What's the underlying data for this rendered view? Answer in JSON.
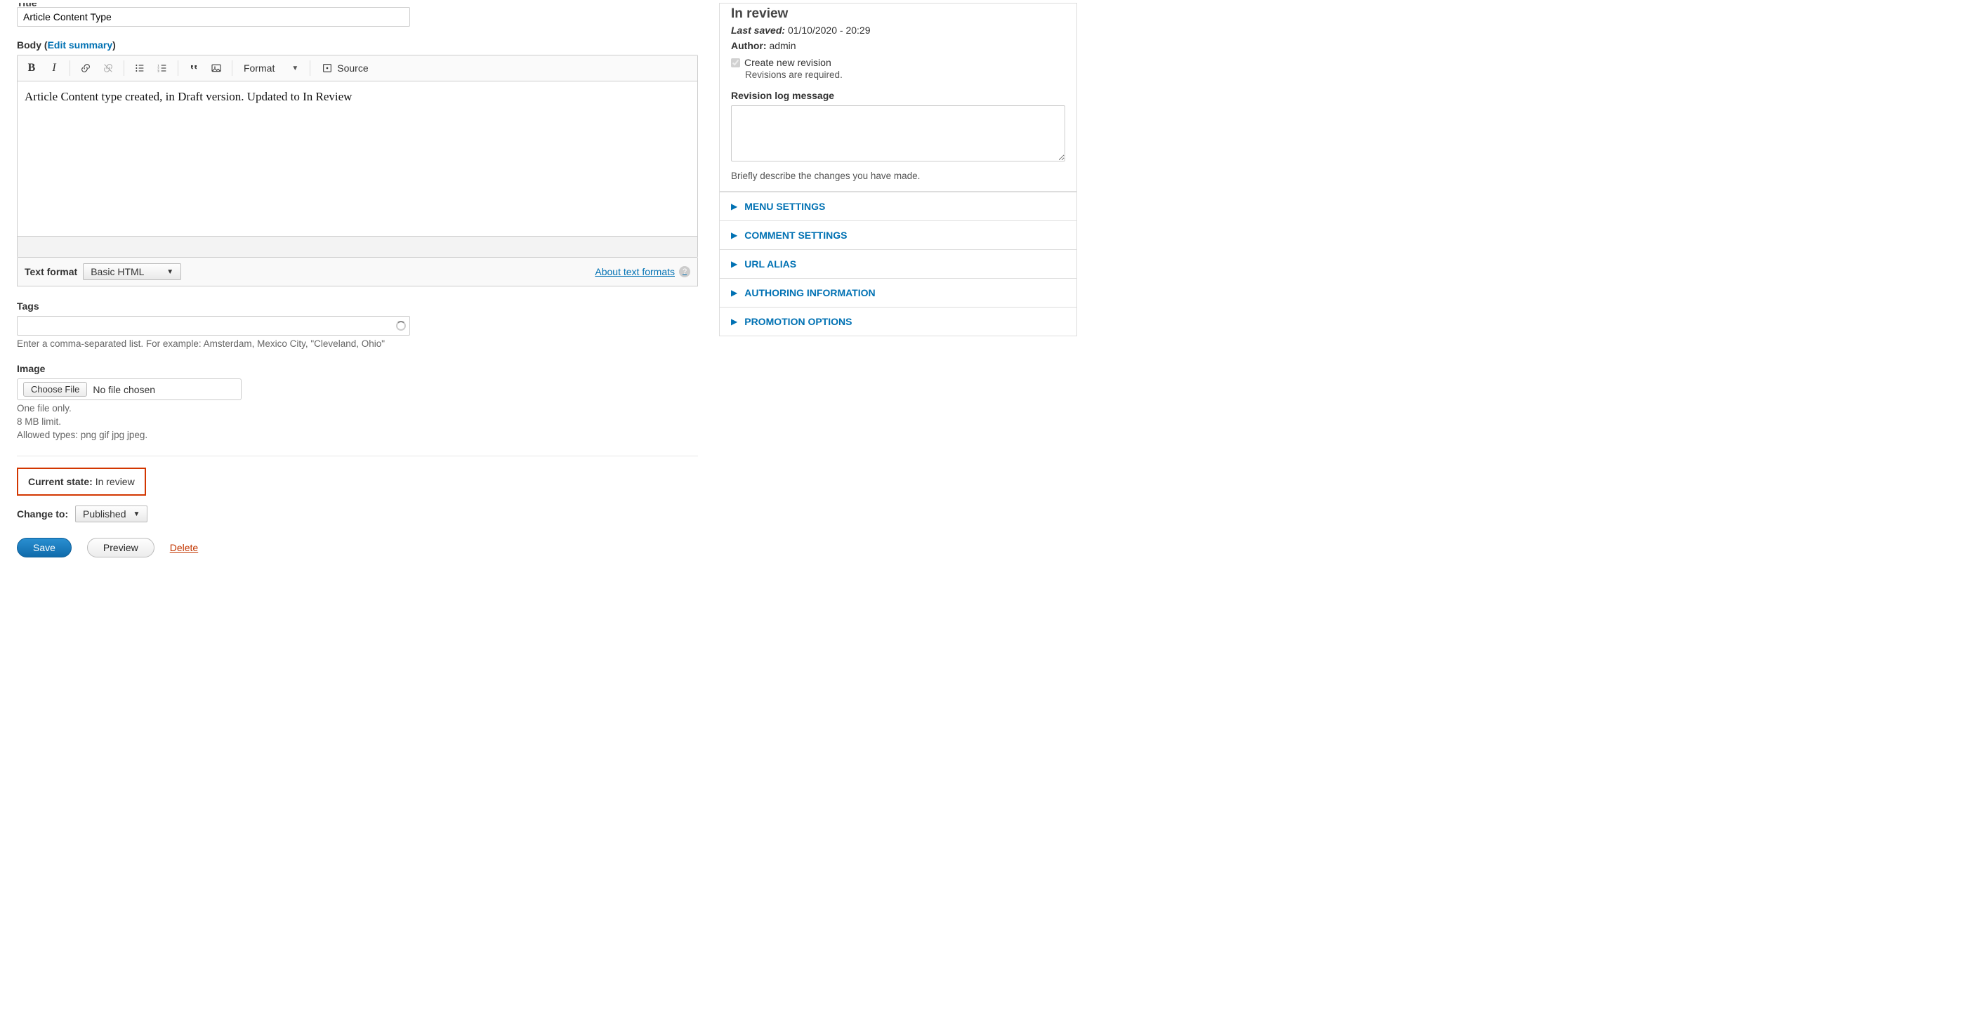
{
  "title_label": "Title",
  "title_value": "Article Content Type",
  "body": {
    "label": "Body",
    "edit_summary_link": "Edit summary",
    "content": "Article Content type created, in Draft version. Updated to In Review",
    "format_dropdown": "Format",
    "source_button": "Source"
  },
  "text_format": {
    "label": "Text format",
    "selected": "Basic HTML",
    "about_link": "About text formats"
  },
  "tags": {
    "label": "Tags",
    "hint": "Enter a comma-separated list. For example: Amsterdam, Mexico City, \"Cleveland, Ohio\""
  },
  "image": {
    "label": "Image",
    "choose_button": "Choose File",
    "status": "No file chosen",
    "hint1": "One file only.",
    "hint2": "8 MB limit.",
    "hint3": "Allowed types: png gif jpg jpeg."
  },
  "moderation": {
    "current_label": "Current state:",
    "current_value": "In review",
    "change_label": "Change to:",
    "change_value": "Published"
  },
  "actions": {
    "save": "Save",
    "preview": "Preview",
    "delete": "Delete"
  },
  "sidebar": {
    "state": "In review",
    "last_saved_label": "Last saved:",
    "last_saved_value": "01/10/2020 - 20:29",
    "author_label": "Author:",
    "author_value": "admin",
    "revision_checkbox": "Create new revision",
    "revisions_required": "Revisions are required.",
    "revlog_label": "Revision log message",
    "revlog_hint": "Briefly describe the changes you have made.",
    "accordion": [
      "MENU SETTINGS",
      "COMMENT SETTINGS",
      "URL ALIAS",
      "AUTHORING INFORMATION",
      "PROMOTION OPTIONS"
    ]
  }
}
